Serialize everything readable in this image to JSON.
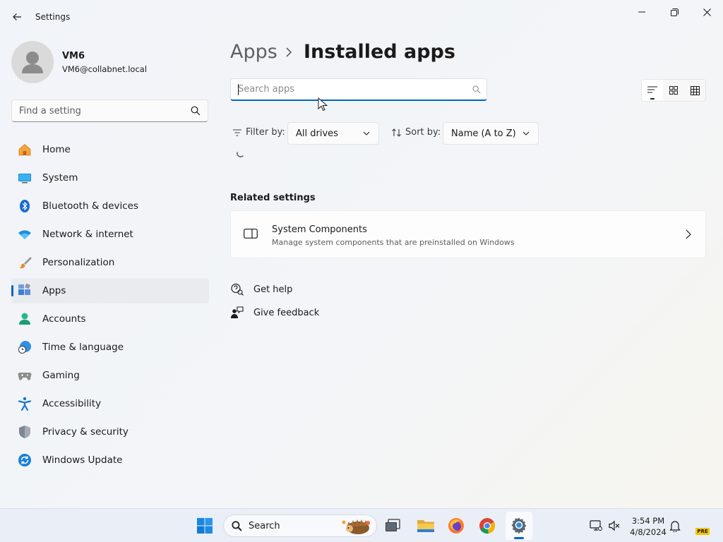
{
  "window": {
    "title": "Settings"
  },
  "profile": {
    "name": "VM6",
    "email": "VM6@collabnet.local"
  },
  "sidebar": {
    "search_placeholder": "Find a setting",
    "items": [
      {
        "label": "Home",
        "icon": "home-icon"
      },
      {
        "label": "System",
        "icon": "system-icon"
      },
      {
        "label": "Bluetooth & devices",
        "icon": "bluetooth-icon"
      },
      {
        "label": "Network & internet",
        "icon": "wifi-icon"
      },
      {
        "label": "Personalization",
        "icon": "brush-icon"
      },
      {
        "label": "Apps",
        "icon": "apps-icon",
        "active": true
      },
      {
        "label": "Accounts",
        "icon": "account-icon"
      },
      {
        "label": "Time & language",
        "icon": "clock-globe-icon"
      },
      {
        "label": "Gaming",
        "icon": "gamepad-icon"
      },
      {
        "label": "Accessibility",
        "icon": "accessibility-icon"
      },
      {
        "label": "Privacy & security",
        "icon": "shield-icon"
      },
      {
        "label": "Windows Update",
        "icon": "update-icon"
      }
    ]
  },
  "main": {
    "breadcrumb": {
      "parent": "Apps",
      "current": "Installed apps"
    },
    "search_placeholder": "Search apps",
    "filter": {
      "label": "Filter by:",
      "value": "All drives"
    },
    "sort": {
      "label": "Sort by:",
      "value": "Name (A to Z)"
    },
    "related": {
      "title": "Related settings",
      "card": {
        "title": "System Components",
        "subtitle": "Manage system components that are preinstalled on Windows"
      }
    },
    "links": {
      "help": "Get help",
      "feedback": "Give feedback"
    }
  },
  "taskbar": {
    "search_label": "Search",
    "time": "3:54 PM",
    "date": "4/8/2024",
    "badge": "PRE"
  },
  "colors": {
    "accent": "#0067c0"
  }
}
